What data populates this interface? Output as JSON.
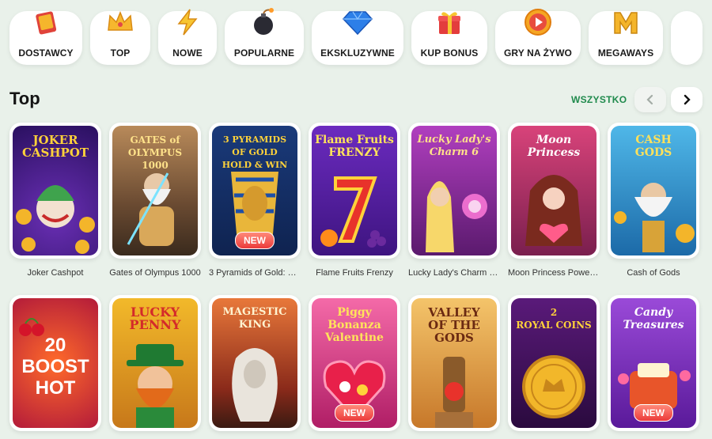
{
  "categories": [
    {
      "label": "DOSTAWCY",
      "icon": "book-icon"
    },
    {
      "label": "TOP",
      "icon": "crown-icon"
    },
    {
      "label": "NOWE",
      "icon": "lightning-icon"
    },
    {
      "label": "POPULARNE",
      "icon": "bomb-icon"
    },
    {
      "label": "EKSKLUZYWNE",
      "icon": "diamond-icon"
    },
    {
      "label": "KUP BONUS",
      "icon": "gift-icon"
    },
    {
      "label": "GRY NA ŻYWO",
      "icon": "play-icon"
    },
    {
      "label": "MEGAWAYS",
      "icon": "m-letter-icon"
    }
  ],
  "section": {
    "title": "Top",
    "see_all": "WSZYSTKO",
    "prev_icon": "chevron-left-icon",
    "next_icon": "chevron-right-icon"
  },
  "games": [
    {
      "name": "Joker Cashpot",
      "art": "JOKER\nCASHPOT",
      "badge": ""
    },
    {
      "name": "Gates of Olympus 1000",
      "art": "GATES of OLYMPUS\n1000",
      "badge": ""
    },
    {
      "name": "3 Pyramids of Gold: Hol...",
      "art": "3 PYRAMIDS OF GOLD\nHOLD & WIN",
      "badge": "NEW"
    },
    {
      "name": "Flame Fruits Frenzy",
      "art": "Flame Fruits\nFRENZY",
      "badge": ""
    },
    {
      "name": "Lucky Lady's Charm De...",
      "art": "Lucky Lady's\nCharm 6",
      "badge": ""
    },
    {
      "name": "Moon Princess Power o...",
      "art": "Moon\nPrincess",
      "badge": ""
    },
    {
      "name": "Cash of Gods",
      "art": "CASH\nGODS",
      "badge": ""
    },
    {
      "name": "",
      "art": "20\nBOOST\nHOT",
      "badge": ""
    },
    {
      "name": "",
      "art": "LUCKY\nPENNY",
      "badge": ""
    },
    {
      "name": "",
      "art": "MAGESTIC\nKING",
      "badge": ""
    },
    {
      "name": "",
      "art": "Piggy\nBonanza\nValentine",
      "badge": "NEW"
    },
    {
      "name": "",
      "art": "VALLEY\nOF THE\nGODS",
      "badge": ""
    },
    {
      "name": "",
      "art": "2\nROYAL COINS",
      "badge": ""
    },
    {
      "name": "",
      "art": "Candy\nTreasures",
      "badge": "NEW"
    }
  ],
  "colors": {
    "background": "#e9f1ea",
    "accent": "#1f8a4c",
    "badge": "#ec3a3a"
  }
}
